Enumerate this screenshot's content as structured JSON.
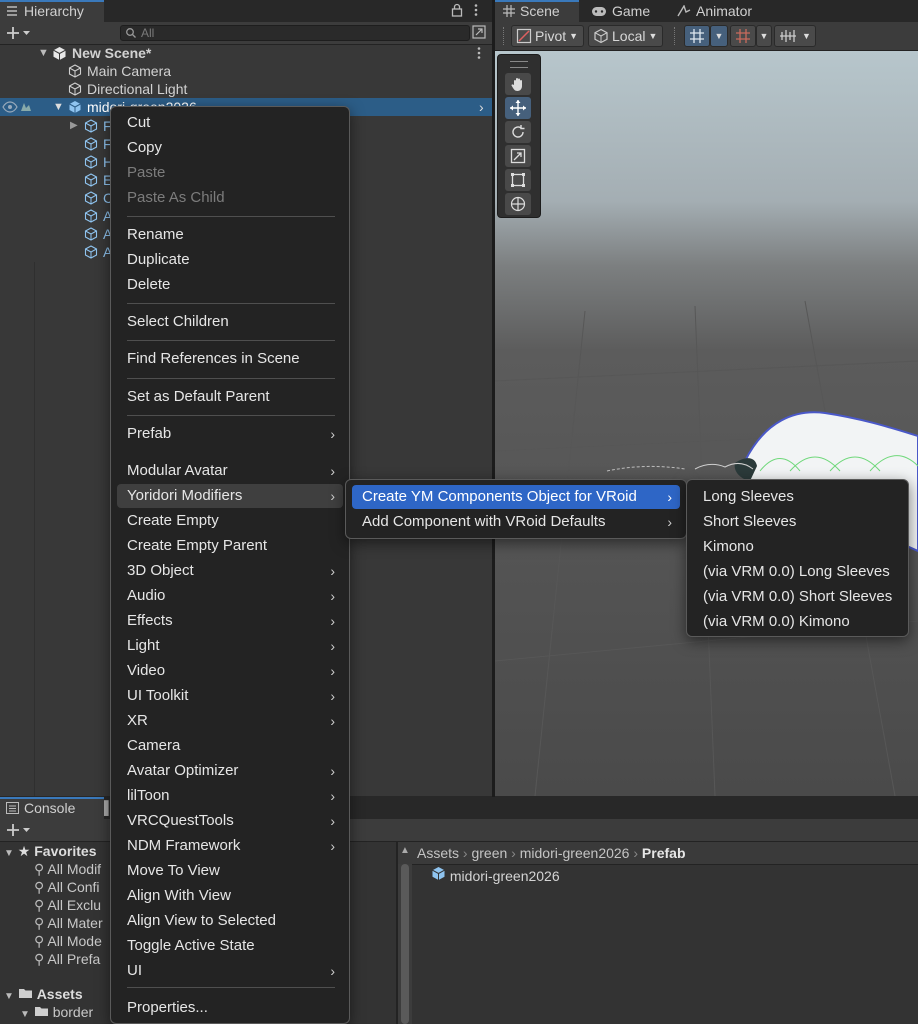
{
  "hierarchy": {
    "tab_label": "Hierarchy",
    "search_placeholder": "All",
    "rows": [
      "New Scene*",
      "Main Camera",
      "Directional Light",
      "midori-green2026"
    ],
    "child_letters": [
      "F",
      "F",
      "H",
      "E",
      "C",
      "A",
      "A",
      "A"
    ]
  },
  "scene": {
    "tabs": [
      "Scene",
      "Game",
      "Animator"
    ],
    "pivot_label": "Pivot",
    "local_label": "Local"
  },
  "context_menu": {
    "items": [
      {
        "label": "Cut"
      },
      {
        "label": "Copy"
      },
      {
        "label": "Paste",
        "disabled": true
      },
      {
        "label": "Paste As Child",
        "disabled": true
      },
      {
        "label": "Rename"
      },
      {
        "label": "Duplicate"
      },
      {
        "label": "Delete"
      },
      {
        "label": "Select Children"
      },
      {
        "label": "Find References in Scene"
      },
      {
        "label": "Set as Default Parent"
      },
      {
        "label": "Prefab",
        "submenu": true
      },
      {
        "label": "Modular Avatar",
        "submenu": true
      },
      {
        "label": "Yoridori Modifiers",
        "submenu": true,
        "highlighted": true
      },
      {
        "label": "Create Empty"
      },
      {
        "label": "Create Empty Parent"
      },
      {
        "label": "3D Object",
        "submenu": true
      },
      {
        "label": "Audio",
        "submenu": true
      },
      {
        "label": "Effects",
        "submenu": true
      },
      {
        "label": "Light",
        "submenu": true
      },
      {
        "label": "Video",
        "submenu": true
      },
      {
        "label": "UI Toolkit",
        "submenu": true
      },
      {
        "label": "XR",
        "submenu": true
      },
      {
        "label": "Camera"
      },
      {
        "label": "Avatar Optimizer",
        "submenu": true
      },
      {
        "label": "lilToon",
        "submenu": true
      },
      {
        "label": "VRCQuestTools",
        "submenu": true
      },
      {
        "label": "NDM Framework",
        "submenu": true
      },
      {
        "label": "Move To View"
      },
      {
        "label": "Align With View"
      },
      {
        "label": "Align View to Selected"
      },
      {
        "label": "Toggle Active State"
      },
      {
        "label": "UI",
        "submenu": true
      },
      {
        "label": "Properties..."
      }
    ]
  },
  "submenu_1": {
    "items": [
      {
        "label": "Create YM Components Object for VRoid",
        "submenu": true,
        "selected": true
      },
      {
        "label": "Add Component with VRoid Defaults",
        "submenu": true
      }
    ]
  },
  "submenu_2": {
    "items": [
      {
        "label": "Long Sleeves"
      },
      {
        "label": "Short Sleeves"
      },
      {
        "label": "Kimono"
      },
      {
        "label": "(via VRM 0.0) Long Sleeves"
      },
      {
        "label": "(via VRM 0.0) Short Sleeves"
      },
      {
        "label": "(via VRM 0.0) Kimono"
      }
    ]
  },
  "console": {
    "tab_label": "Console"
  },
  "project": {
    "favorites_label": "Favorites",
    "favorites": [
      "All Modif",
      "All Confi",
      "All Exclu",
      "All Mater",
      "All Mode",
      "All Prefa"
    ],
    "assets_label": "Assets",
    "assets_child": "border",
    "breadcrumb": [
      "Assets",
      "green",
      "midori-green2026",
      "Prefab"
    ],
    "file": "midori-green2026"
  },
  "colors": {
    "accent": "#2e66c6",
    "panel": "#383838",
    "menu_bg": "#232323"
  },
  "icons": [
    "hamburger-icon",
    "lock-icon",
    "kebab-icon",
    "plus-icon",
    "search-icon",
    "unity-cube-icon",
    "prefab-cube-icon",
    "eye-icon",
    "hand-icon",
    "move-icon",
    "rotate-icon",
    "scale-icon",
    "rect-icon",
    "transform-icon",
    "star-icon",
    "folder-icon",
    "chevron-right-icon"
  ]
}
